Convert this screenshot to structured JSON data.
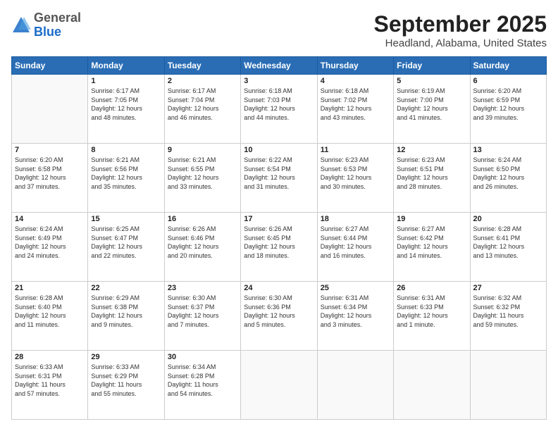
{
  "header": {
    "logo": {
      "line1": "General",
      "line2": "Blue"
    },
    "title": "September 2025",
    "location": "Headland, Alabama, United States"
  },
  "weekdays": [
    "Sunday",
    "Monday",
    "Tuesday",
    "Wednesday",
    "Thursday",
    "Friday",
    "Saturday"
  ],
  "weeks": [
    [
      {
        "day": "",
        "info": ""
      },
      {
        "day": "1",
        "info": "Sunrise: 6:17 AM\nSunset: 7:05 PM\nDaylight: 12 hours\nand 48 minutes."
      },
      {
        "day": "2",
        "info": "Sunrise: 6:17 AM\nSunset: 7:04 PM\nDaylight: 12 hours\nand 46 minutes."
      },
      {
        "day": "3",
        "info": "Sunrise: 6:18 AM\nSunset: 7:03 PM\nDaylight: 12 hours\nand 44 minutes."
      },
      {
        "day": "4",
        "info": "Sunrise: 6:18 AM\nSunset: 7:02 PM\nDaylight: 12 hours\nand 43 minutes."
      },
      {
        "day": "5",
        "info": "Sunrise: 6:19 AM\nSunset: 7:00 PM\nDaylight: 12 hours\nand 41 minutes."
      },
      {
        "day": "6",
        "info": "Sunrise: 6:20 AM\nSunset: 6:59 PM\nDaylight: 12 hours\nand 39 minutes."
      }
    ],
    [
      {
        "day": "7",
        "info": "Sunrise: 6:20 AM\nSunset: 6:58 PM\nDaylight: 12 hours\nand 37 minutes."
      },
      {
        "day": "8",
        "info": "Sunrise: 6:21 AM\nSunset: 6:56 PM\nDaylight: 12 hours\nand 35 minutes."
      },
      {
        "day": "9",
        "info": "Sunrise: 6:21 AM\nSunset: 6:55 PM\nDaylight: 12 hours\nand 33 minutes."
      },
      {
        "day": "10",
        "info": "Sunrise: 6:22 AM\nSunset: 6:54 PM\nDaylight: 12 hours\nand 31 minutes."
      },
      {
        "day": "11",
        "info": "Sunrise: 6:23 AM\nSunset: 6:53 PM\nDaylight: 12 hours\nand 30 minutes."
      },
      {
        "day": "12",
        "info": "Sunrise: 6:23 AM\nSunset: 6:51 PM\nDaylight: 12 hours\nand 28 minutes."
      },
      {
        "day": "13",
        "info": "Sunrise: 6:24 AM\nSunset: 6:50 PM\nDaylight: 12 hours\nand 26 minutes."
      }
    ],
    [
      {
        "day": "14",
        "info": "Sunrise: 6:24 AM\nSunset: 6:49 PM\nDaylight: 12 hours\nand 24 minutes."
      },
      {
        "day": "15",
        "info": "Sunrise: 6:25 AM\nSunset: 6:47 PM\nDaylight: 12 hours\nand 22 minutes."
      },
      {
        "day": "16",
        "info": "Sunrise: 6:26 AM\nSunset: 6:46 PM\nDaylight: 12 hours\nand 20 minutes."
      },
      {
        "day": "17",
        "info": "Sunrise: 6:26 AM\nSunset: 6:45 PM\nDaylight: 12 hours\nand 18 minutes."
      },
      {
        "day": "18",
        "info": "Sunrise: 6:27 AM\nSunset: 6:44 PM\nDaylight: 12 hours\nand 16 minutes."
      },
      {
        "day": "19",
        "info": "Sunrise: 6:27 AM\nSunset: 6:42 PM\nDaylight: 12 hours\nand 14 minutes."
      },
      {
        "day": "20",
        "info": "Sunrise: 6:28 AM\nSunset: 6:41 PM\nDaylight: 12 hours\nand 13 minutes."
      }
    ],
    [
      {
        "day": "21",
        "info": "Sunrise: 6:28 AM\nSunset: 6:40 PM\nDaylight: 12 hours\nand 11 minutes."
      },
      {
        "day": "22",
        "info": "Sunrise: 6:29 AM\nSunset: 6:38 PM\nDaylight: 12 hours\nand 9 minutes."
      },
      {
        "day": "23",
        "info": "Sunrise: 6:30 AM\nSunset: 6:37 PM\nDaylight: 12 hours\nand 7 minutes."
      },
      {
        "day": "24",
        "info": "Sunrise: 6:30 AM\nSunset: 6:36 PM\nDaylight: 12 hours\nand 5 minutes."
      },
      {
        "day": "25",
        "info": "Sunrise: 6:31 AM\nSunset: 6:34 PM\nDaylight: 12 hours\nand 3 minutes."
      },
      {
        "day": "26",
        "info": "Sunrise: 6:31 AM\nSunset: 6:33 PM\nDaylight: 12 hours\nand 1 minute."
      },
      {
        "day": "27",
        "info": "Sunrise: 6:32 AM\nSunset: 6:32 PM\nDaylight: 11 hours\nand 59 minutes."
      }
    ],
    [
      {
        "day": "28",
        "info": "Sunrise: 6:33 AM\nSunset: 6:31 PM\nDaylight: 11 hours\nand 57 minutes."
      },
      {
        "day": "29",
        "info": "Sunrise: 6:33 AM\nSunset: 6:29 PM\nDaylight: 11 hours\nand 55 minutes."
      },
      {
        "day": "30",
        "info": "Sunrise: 6:34 AM\nSunset: 6:28 PM\nDaylight: 11 hours\nand 54 minutes."
      },
      {
        "day": "",
        "info": ""
      },
      {
        "day": "",
        "info": ""
      },
      {
        "day": "",
        "info": ""
      },
      {
        "day": "",
        "info": ""
      }
    ]
  ]
}
